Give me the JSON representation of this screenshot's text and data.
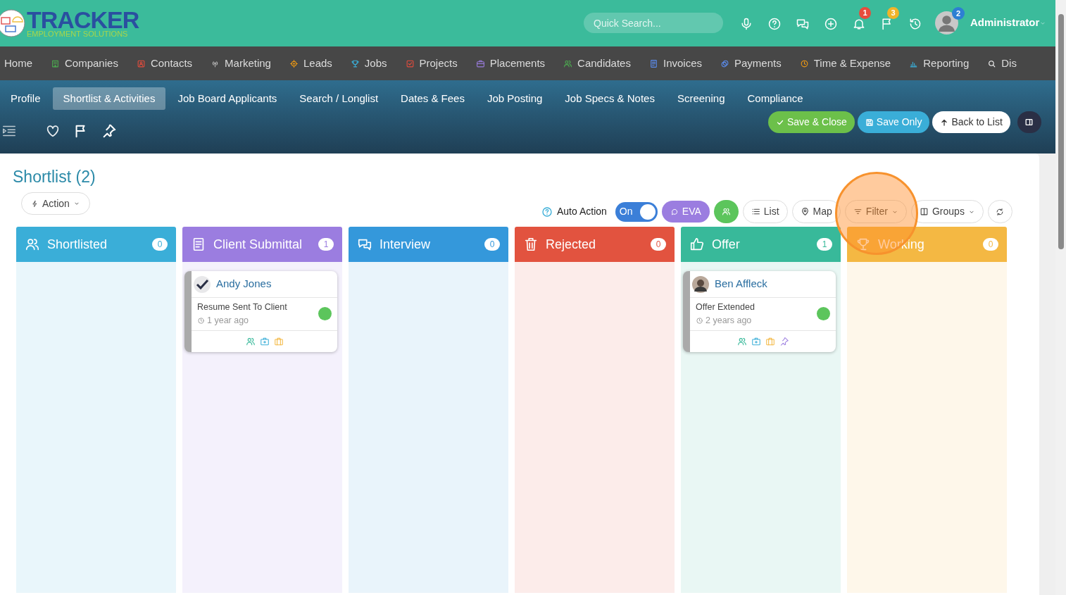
{
  "logo": {
    "title": "TRACKER",
    "subtitle": "EMPLOYMENT SOLUTIONS"
  },
  "search": {
    "placeholder": "Quick Search..."
  },
  "notifications_badge": "1",
  "flags_badge": "3",
  "user": {
    "name": "Administrator",
    "badge": "2"
  },
  "main_nav": [
    {
      "label": "Home"
    },
    {
      "label": "Companies"
    },
    {
      "label": "Contacts"
    },
    {
      "label": "Marketing"
    },
    {
      "label": "Leads"
    },
    {
      "label": "Jobs"
    },
    {
      "label": "Projects"
    },
    {
      "label": "Placements"
    },
    {
      "label": "Candidates"
    },
    {
      "label": "Invoices"
    },
    {
      "label": "Payments"
    },
    {
      "label": "Time & Expense"
    },
    {
      "label": "Reporting"
    },
    {
      "label": "Dis"
    }
  ],
  "sub_tabs": [
    {
      "label": "Profile",
      "selected": false
    },
    {
      "label": "Shortlist & Activities",
      "selected": true
    },
    {
      "label": "Job Board Applicants",
      "selected": false
    },
    {
      "label": "Search / Longlist",
      "selected": false
    },
    {
      "label": "Dates & Fees",
      "selected": false
    },
    {
      "label": "Job Posting",
      "selected": false
    },
    {
      "label": "Job Specs & Notes",
      "selected": false
    },
    {
      "label": "Screening",
      "selected": false
    },
    {
      "label": "Compliance",
      "selected": false
    }
  ],
  "actions": [
    "Save & Close",
    "Save Only",
    "Back to List"
  ],
  "page_title": "Shortlist (2)",
  "action_button": "Action",
  "toolbar": {
    "auto_action": "Auto Action",
    "toggle": {
      "label": "On",
      "on": true
    },
    "eva": "EVA",
    "list": "List",
    "map": "Map",
    "filter": "Filter",
    "groups": "Groups"
  },
  "columns": [
    {
      "title": "Shortlisted",
      "count": "0",
      "color": "#3aaed8"
    },
    {
      "title": "Client Submittal",
      "count": "1",
      "color": "#9b7de0",
      "cards": [
        {
          "name": "Andy Jones",
          "status": "Resume Sent To Client",
          "time": "1 year ago",
          "pinned": false
        }
      ]
    },
    {
      "title": "Interview",
      "count": "0",
      "color": "#3498db"
    },
    {
      "title": "Rejected",
      "count": "0",
      "color": "#e2533f"
    },
    {
      "title": "Offer",
      "count": "1",
      "color": "#38b99a",
      "cards": [
        {
          "name": "Ben Affleck",
          "status": "Offer Extended",
          "time": "2 years ago",
          "pinned": true
        }
      ]
    },
    {
      "title": "Working",
      "count": "0",
      "color": "#f4b843"
    }
  ]
}
